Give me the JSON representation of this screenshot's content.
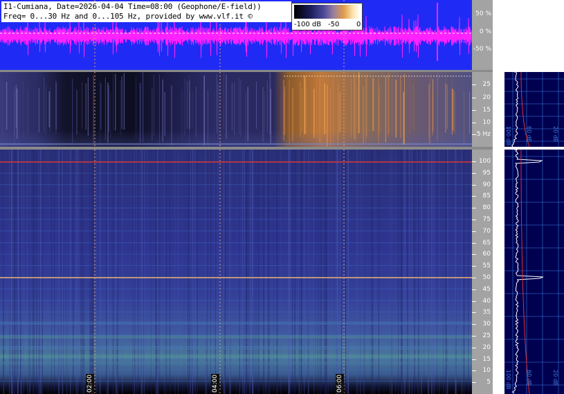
{
  "title": {
    "line1": "I1-Cumiana, Date=2026-04-04 Time=08:00 (Geophone/E-field))",
    "line2": "Freq= 0...30 Hz and 0...105 Hz, provided by www.vlf.it ©"
  },
  "colorbar": {
    "labels": [
      "-100 dB",
      "-50",
      "0"
    ]
  },
  "percent_axis": {
    "labels": [
      "50 %",
      "0 %",
      "-50 %"
    ]
  },
  "mid_axis": {
    "labels": [
      "25",
      "20",
      "15",
      "10",
      "5 Hz"
    ]
  },
  "low_axis": {
    "labels": [
      "100",
      "95",
      "90",
      "85",
      "80",
      "75",
      "70",
      "65",
      "60",
      "55",
      "50",
      "45",
      "40",
      "35",
      "30",
      "25",
      "20",
      "15",
      "10",
      "5"
    ]
  },
  "time_axis": {
    "labels": [
      "02:00",
      "04:00",
      "06:00"
    ]
  },
  "mid_plot_db": {
    "labels": [
      "100 dB",
      "60 dB",
      "20 dB"
    ]
  },
  "low_plot_db": {
    "labels": [
      "100 dB",
      "60 dB",
      "20 dB"
    ]
  },
  "colors": {
    "wave_background": "#1f2bf5",
    "wave_trace": "#ff22ff",
    "axis_background": "#a3a3a3",
    "plot_background": "#000050",
    "grid": "#3f7fe0",
    "time_marker": "#e8a070",
    "spectrum_trace": "#ffffff",
    "fit_trace": "#e03030"
  },
  "icons": [
    "copyright-symbol"
  ]
}
